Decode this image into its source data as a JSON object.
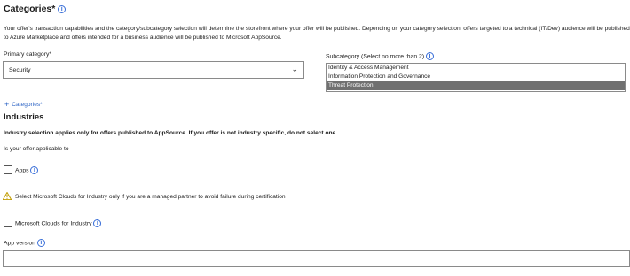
{
  "categories": {
    "title": "Categories*",
    "description_line1": "Your offer's transaction capabilities and the category/subcategory selection will determine the storefront where your offer will be published. Depending on your category selection, offers targeted to a technical (IT/Dev) audience will be published",
    "description_line2": "to Azure Marketplace and offers intended for a business audience will be published to Microsoft AppSource.",
    "primary_label": "Primary category*",
    "primary_value": "Security",
    "subcategory_label": "Subcategory (Select no more than 2)",
    "subcategory_options": [
      "Identity & Access Management",
      "Information Protection and Governance",
      "Threat Protection"
    ],
    "subcategory_selected_index": 2,
    "add_link": "Categories*"
  },
  "industries": {
    "title": "Industries",
    "note": "Industry selection applies only for offers published to AppSource. If you offer is not industry specific, do not select one.",
    "question": "Is your offer applicable to",
    "apps_label": "Apps",
    "warning_text": "Select Microsoft Clouds for Industry only if you are a managed partner to avoid failure during certification",
    "clouds_label": "Microsoft Clouds for Industry"
  },
  "app_version": {
    "label": "App version",
    "value": ""
  },
  "colors": {
    "accent": "#2a62c4",
    "selected_row": "#707070",
    "warning": "#c19c00"
  }
}
